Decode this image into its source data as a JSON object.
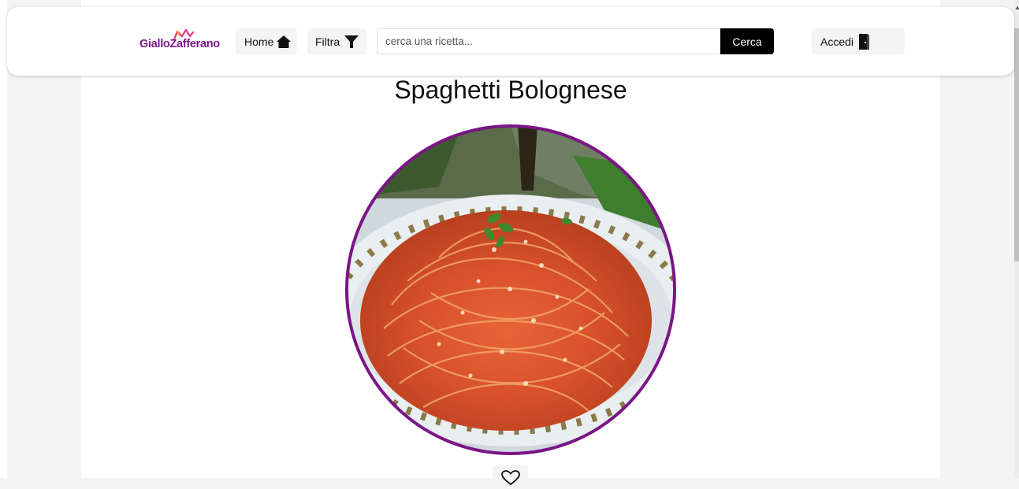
{
  "brand": {
    "logo_text": "GialloZafferano",
    "accent_color": "#7d1b8c"
  },
  "navbar": {
    "home_label": "Home",
    "home_icon": "home-icon",
    "filter_label": "Filtra",
    "filter_icon": "filter-funnel-icon",
    "login_label": "Accedi",
    "login_icon": "door-icon"
  },
  "search": {
    "value": "",
    "placeholder": "cerca una ricetta...",
    "button_label": "Cerca"
  },
  "recipe": {
    "title": "Spaghetti Bolognese",
    "like_icon": "heart-icon"
  }
}
